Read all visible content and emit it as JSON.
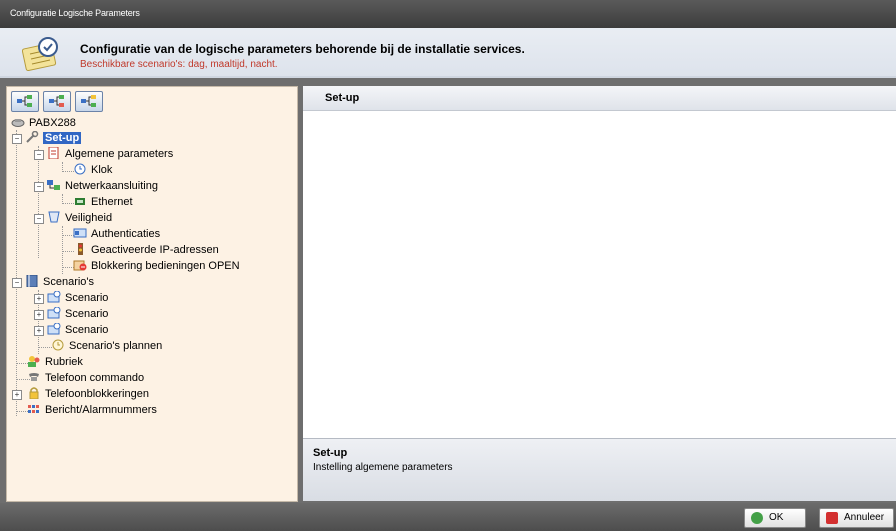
{
  "window": {
    "title": "Configuratie Logische Parameters"
  },
  "header": {
    "title": "Configuratie van de logische parameters behorende bij de installatie services.",
    "subtitle": "Beschikbare scenario's: dag, maaltijd, nacht."
  },
  "tree": {
    "root": "PABX288",
    "setup": "Set-up",
    "algemene": "Algemene parameters",
    "klok": "Klok",
    "netwerk": "Netwerkaansluiting",
    "ethernet": "Ethernet",
    "veiligheid": "Veiligheid",
    "authenticaties": "Authenticaties",
    "ipadressen": "Geactiveerde IP-adressen",
    "blokkering": "Blokkering bedieningen OPEN",
    "scenarios": "Scenario's",
    "scenario1": "Scenario",
    "scenario2": "Scenario",
    "scenario3": "Scenario",
    "plannen": "Scenario's plannen",
    "rubriek": "Rubriek",
    "telefoon_commando": "Telefoon commando",
    "telefoonblokkeringen": "Telefoonblokkeringen",
    "bericht": "Bericht/Alarmnummers"
  },
  "panel": {
    "header": "Set-up",
    "footer_title": "Set-up",
    "footer_desc": "Instelling algemene parameters"
  },
  "buttons": {
    "ok": "OK",
    "cancel": "Annuleer"
  },
  "colors": {
    "selection": "#3167c4",
    "subtitle": "#c0392b",
    "tree_bg": "#fdf2e4"
  }
}
